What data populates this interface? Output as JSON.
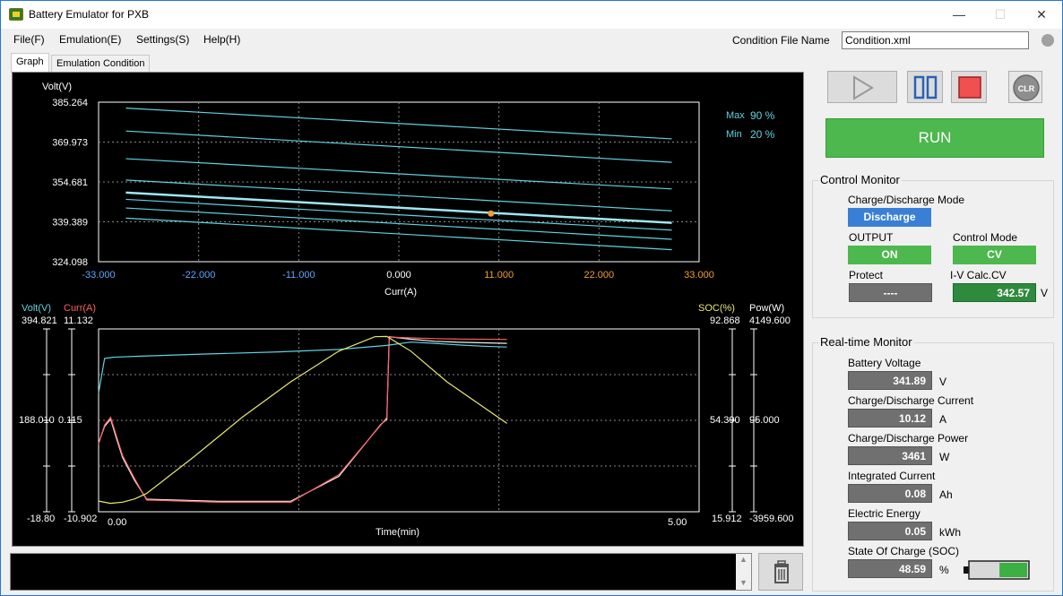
{
  "window": {
    "title": "Battery Emulator for PXB",
    "minimize": "—",
    "maximize": "☐",
    "close": "✕"
  },
  "menu": [
    {
      "label": "File(F)"
    },
    {
      "label": "Emulation(E)"
    },
    {
      "label": "Settings(S)"
    },
    {
      "label": "Help(H)"
    }
  ],
  "condition_file": {
    "label": "Condition File Name",
    "value": "Condition.xml"
  },
  "tabs": [
    {
      "label": "Graph",
      "active": true
    },
    {
      "label": "Emulation Condition",
      "active": false
    }
  ],
  "controls": {
    "run_label": "RUN",
    "clear_label": "CLR"
  },
  "control_monitor": {
    "title": "Control Monitor",
    "mode_label": "Charge/Discharge Mode",
    "mode_value": "Discharge",
    "output_label": "OUTPUT",
    "output_value": "ON",
    "control_mode_label": "Control Mode",
    "control_mode_value": "CV",
    "protect_label": "Protect",
    "protect_value": "----",
    "iv_label": "I-V Calc.CV",
    "iv_value": "342.57",
    "iv_unit": "V"
  },
  "realtime_monitor": {
    "title": "Real-time Monitor",
    "items": [
      {
        "label": "Battery Voltage",
        "value": "341.89",
        "unit": "V"
      },
      {
        "label": "Charge/Discharge Current",
        "value": "10.12",
        "unit": "A"
      },
      {
        "label": "Charge/Discharge Power",
        "value": "3461",
        "unit": "W"
      },
      {
        "label": "Integrated Current",
        "value": "0.08",
        "unit": "Ah"
      },
      {
        "label": "Electric Energy",
        "value": "0.05",
        "unit": "kWh"
      },
      {
        "label": "State Of Charge (SOC)",
        "value": "48.59",
        "unit": "%"
      }
    ],
    "battery_level": 0.49
  },
  "colors": {
    "run": "#4db84d",
    "discharge": "#3a7fd6",
    "on": "#4db84d",
    "cv": "#4db84d",
    "iv": "#2e8b3e",
    "cyan": "#5fd3e0",
    "orange": "#f0a030"
  },
  "chart_data": [
    {
      "type": "line",
      "ylabel": "Volt(V)",
      "xlabel": "Curr(A)",
      "y_ticks": [
        "385.264",
        "369.973",
        "354.681",
        "339.389",
        "324.098"
      ],
      "x_ticks": [
        "-33.000",
        "-22.000",
        "-11.000",
        "0.000",
        "11.000",
        "22.000",
        "33.000"
      ],
      "xlim": [
        -33,
        33
      ],
      "ylim": [
        324.098,
        385.264
      ],
      "legend": {
        "max_label": "Max",
        "max_value": "90 %",
        "min_label": "Min",
        "min_value": "20 %"
      },
      "series": [
        {
          "x": [
            -30,
            30
          ],
          "y": [
            383.0,
            371.2
          ]
        },
        {
          "x": [
            -30,
            30
          ],
          "y": [
            374.2,
            362.2
          ]
        },
        {
          "x": [
            -30,
            30
          ],
          "y": [
            363.6,
            352.0
          ]
        },
        {
          "x": [
            -30,
            30
          ],
          "y": [
            355.4,
            343.6
          ]
        },
        {
          "x": [
            -30,
            30
          ],
          "y": [
            350.6,
            339.0
          ]
        },
        {
          "x": [
            -30,
            30
          ],
          "y": [
            348.0,
            336.2
          ]
        },
        {
          "x": [
            -30,
            30
          ],
          "y": [
            344.7,
            332.7
          ]
        },
        {
          "x": [
            -30,
            30
          ],
          "y": [
            340.8,
            328.7
          ]
        }
      ],
      "highlight_series": {
        "x": [
          -30,
          30
        ],
        "y": [
          350.6,
          339.0
        ]
      },
      "operating_point": {
        "x": 10.12,
        "y": 342.57
      }
    },
    {
      "type": "line",
      "xlabel": "Time(min)",
      "x_ticks": [
        "0.00",
        "5.00"
      ],
      "xlim": [
        0,
        5
      ],
      "axes": {
        "volt": {
          "label": "Volt(V)",
          "max": "394.821",
          "mid": "188.010",
          "min": "-18.80",
          "range": [
            -18.8,
            394.821
          ]
        },
        "curr": {
          "label": "Curr(A)",
          "max": "11.132",
          "mid": "0.115",
          "min": "-10.902",
          "range": [
            -10.902,
            11.132
          ]
        },
        "soc": {
          "label": "SOC(%)",
          "max": "92.868",
          "mid": "54.390",
          "min": "15.912",
          "range": [
            15.912,
            92.868
          ]
        },
        "pow": {
          "label": "Pow(W)",
          "max": "4149.600",
          "mid": "95.000",
          "min": "-3959.600",
          "range": [
            -3959.6,
            4149.6
          ]
        }
      },
      "series": [
        {
          "name": "Volt(V)",
          "axis": "volt",
          "color": "#5fd3e0",
          "x": [
            0,
            0.05,
            0.12,
            0.3,
            0.8,
            1.5,
            2.0,
            2.4,
            2.6,
            2.8,
            3.0,
            3.2,
            3.4
          ],
          "y": [
            255,
            340,
            343,
            345,
            350,
            356,
            362,
            372,
            380,
            377,
            373,
            370,
            368
          ]
        },
        {
          "name": "Curr(A)",
          "axis": "curr",
          "color": "#ff6060",
          "x": [
            0,
            0.05,
            0.1,
            0.15,
            0.2,
            0.3,
            0.4,
            1.0,
            1.6,
            2.0,
            2.35,
            2.4,
            2.42,
            2.6,
            2.8,
            3.0,
            3.4
          ],
          "y": [
            -3.0,
            -0.5,
            0.5,
            -2.0,
            -4.5,
            -7.5,
            -10.3,
            -10.6,
            -10.6,
            -7.0,
            -0.5,
            0.5,
            11.0,
            10.9,
            10.8,
            10.75,
            10.7
          ]
        },
        {
          "name": "SOC(%)",
          "axis": "soc",
          "color": "#e8e870",
          "x": [
            0,
            0.1,
            0.2,
            0.3,
            0.4,
            0.8,
            1.2,
            1.6,
            2.0,
            2.3,
            2.4,
            2.6,
            2.9,
            3.4
          ],
          "y": [
            17.5,
            16.5,
            17.0,
            18.5,
            21.0,
            38.0,
            56.0,
            72.0,
            86.0,
            92.6,
            92.7,
            86.0,
            72.0,
            53.0
          ]
        },
        {
          "name": "Pow(W)",
          "axis": "pow",
          "color": "#f0f0f0",
          "x": [
            0,
            0.05,
            0.1,
            0.15,
            0.2,
            0.3,
            0.4,
            1.0,
            1.6,
            2.0,
            2.35,
            2.4,
            2.42,
            2.6,
            2.8,
            3.0,
            3.4
          ],
          "y": [
            -1000,
            -200,
            150,
            -800,
            -1700,
            -2800,
            -3700,
            -3800,
            -3800,
            -2600,
            -100,
            150,
            4120,
            4000,
            3900,
            3850,
            3800
          ]
        }
      ]
    }
  ]
}
